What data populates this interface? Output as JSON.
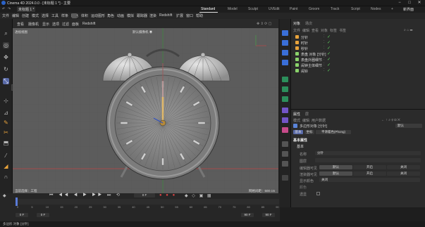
{
  "window": {
    "title": "Cinema 4D 2024.0.0 - [未标题 1 *] - 主要"
  },
  "window_controls": [
    "−",
    "□",
    "✕"
  ],
  "tabs": {
    "doc": "未标题 1 *",
    "items": [
      "Standard",
      "Model",
      "Sculpt",
      "UVEdit",
      "Paint",
      "Groom",
      "Track",
      "Script",
      "Nodes"
    ],
    "active": "Standard",
    "new_layout": "新界面"
  },
  "menu": [
    "文件",
    "编辑",
    "创建",
    "模式",
    "选择",
    "工具",
    "样条",
    "网格",
    "体积",
    "运动图形",
    "角色",
    "动画",
    "模拟",
    "跟踪器",
    "渲染",
    "Redshift",
    "扩展",
    "窗口",
    "帮助"
  ],
  "viewport": {
    "menu": [
      "查看",
      "摄像机",
      "显示",
      "选项",
      "过滤",
      "面板",
      "Redshift"
    ],
    "camera_label": "默认摄像机 ◉",
    "view_name": "透视视图",
    "hud_bottom_left": "当前选择：工程",
    "hud_bottom_right": "网格间距：500 cm"
  },
  "leftbar_popup": "调整",
  "object_manager": {
    "title": "对象",
    "tab2": "场次",
    "menu": [
      "文件",
      "编辑",
      "查看",
      "对象",
      "标签",
      "书签"
    ],
    "items": [
      {
        "name": "分针",
        "indent": 0,
        "color": "#e8a33b"
      },
      {
        "name": "时针",
        "indent": 0,
        "color": "#e8a33b"
      },
      {
        "name": "秒针",
        "indent": 0,
        "color": "#e8a33b"
      },
      {
        "name": "表盘 对象 [分针]",
        "indent": 0,
        "color": "#8ad36b"
      },
      {
        "name": "表盘外圈细节",
        "indent": 0,
        "color": "#8ad36b"
      },
      {
        "name": "闹钟主体细节",
        "indent": 0,
        "color": "#8ad36b"
      },
      {
        "name": "闹铃",
        "indent": 0,
        "color": "#8ad36b"
      }
    ]
  },
  "attributes": {
    "title": "属性",
    "tab2": "层",
    "menu": [
      "模式",
      "编辑",
      "用户数据"
    ],
    "object_title": "多边形对象 [分针]",
    "dropdown": "默认",
    "subtabs": [
      "基本",
      "坐标",
      "平滑着色(Phong)"
    ],
    "section": "基本属性",
    "subsection": "基本",
    "fields": [
      {
        "label": "名称",
        "value": "分针"
      },
      {
        "label": "图层",
        "value": ""
      }
    ],
    "vis_editor_label": "编辑器可见",
    "vis_render_label": "渲染器可见",
    "options": [
      "默认",
      "开启",
      "关闭"
    ],
    "display_color_label": "显示颜色",
    "display_color_value": "关闭",
    "color_label": "颜色",
    "enable_label": "透显"
  },
  "timeline": {
    "ticks": [
      "0",
      "5",
      "10",
      "15",
      "20",
      "25",
      "30",
      "35",
      "40",
      "45",
      "50",
      "55",
      "60",
      "65",
      "70",
      "75",
      "80",
      "85",
      "90"
    ],
    "current_frame": "0 F",
    "start": "0 F",
    "start2": "0 F",
    "end": "90 F",
    "end2": "90 F"
  },
  "status": "多边形 对象 [分针]",
  "colors": {
    "accent": "#596aa8",
    "grid": "#4b4b4b",
    "green": "#5ccf5c"
  }
}
